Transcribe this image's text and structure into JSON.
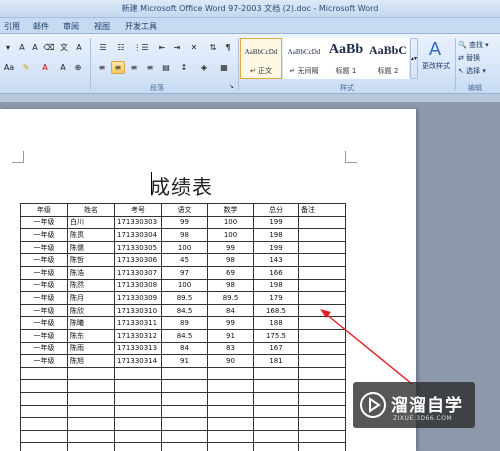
{
  "window": {
    "title": "新建 Microsoft Office Word 97-2003 文档 (2).doc - Microsoft Word"
  },
  "tabs": [
    "引用",
    "邮件",
    "审阅",
    "视图",
    "开发工具"
  ],
  "ribbon": {
    "groups": {
      "paragraph": "段落",
      "styles": "样式",
      "editing": "编辑"
    },
    "styles": [
      {
        "sample": "AaBbCcDd",
        "name": "↵ 正文"
      },
      {
        "sample": "AaBbCcDd",
        "name": "↵ 无间隔"
      },
      {
        "sample": "AaBb",
        "name": "标题 1"
      },
      {
        "sample": "AaBbC",
        "name": "标题 2"
      }
    ],
    "change_styles": "更改样式",
    "editing": {
      "find": "查找 ▾",
      "replace": "替换",
      "select": "选择 ▾"
    }
  },
  "document": {
    "title": "成绩表",
    "table": {
      "headers": [
        "年级",
        "姓名",
        "考号",
        "语文",
        "数学",
        "总分",
        "备注"
      ],
      "rows": [
        [
          "一年级",
          "白川",
          "171330303",
          "99",
          "100",
          "199",
          ""
        ],
        [
          "一年级",
          "陈贯",
          "171330304",
          "98",
          "100",
          "198",
          ""
        ],
        [
          "一年级",
          "陈儒",
          "171330305",
          "100",
          "99",
          "199",
          ""
        ],
        [
          "一年级",
          "陈哲",
          "171330306",
          "45",
          "98",
          "143",
          ""
        ],
        [
          "一年级",
          "陈浩",
          "171330307",
          "97",
          "69",
          "166",
          ""
        ],
        [
          "一年级",
          "陈然",
          "171330308",
          "100",
          "98",
          "198",
          ""
        ],
        [
          "一年级",
          "陈月",
          "171330309",
          "89.5",
          "89.5",
          "179",
          ""
        ],
        [
          "一年级",
          "陈欣",
          "171330310",
          "84.5",
          "84",
          "168.5",
          ""
        ],
        [
          "一年级",
          "陈曦",
          "171330311",
          "89",
          "99",
          "188",
          ""
        ],
        [
          "一年级",
          "陈东",
          "171330312",
          "84.5",
          "91",
          "175.5",
          ""
        ],
        [
          "一年级",
          "陈雨",
          "171330313",
          "84",
          "83",
          "167",
          ""
        ],
        [
          "一年级",
          "陈旭",
          "171330314",
          "91",
          "90",
          "181",
          ""
        ]
      ],
      "empty_rows": 7
    }
  },
  "watermark": {
    "name": "溜溜自学",
    "site": "ZIXUE.3D66.COM"
  },
  "colors": {
    "annotation_arrow": "#e02020"
  }
}
